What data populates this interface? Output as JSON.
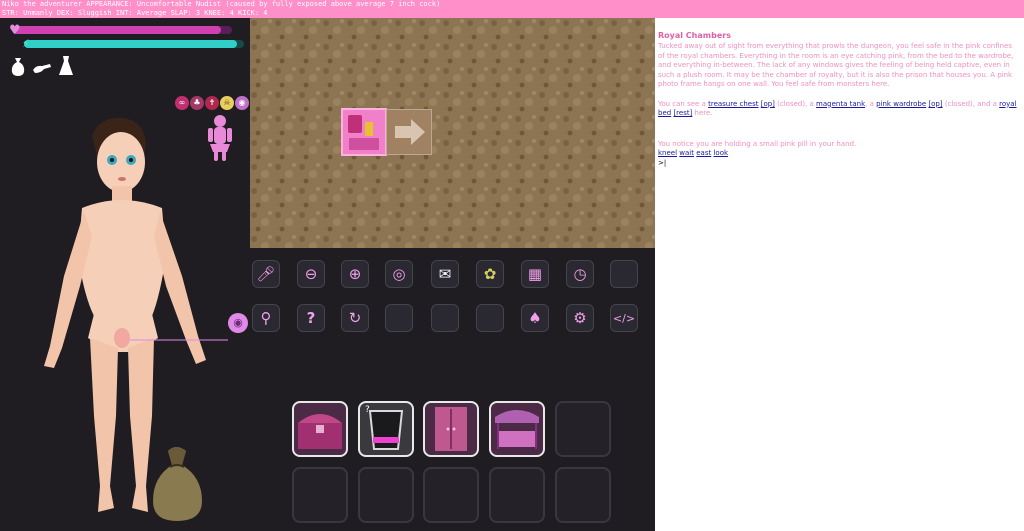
{
  "status": {
    "line1": "Niko the adventurer APPEARANCE: Uncomfortable Nudist (caused by fully exposed above average 7 inch cock)",
    "line2": "STR: Unmanly   DEX: Sluggish  INT: Average    SLAP: 3 KNEE: 4 KICK: 4"
  },
  "bars": {
    "health": 0.95,
    "energy": 0.97
  },
  "colors": {
    "topbar": "#ff8fc8",
    "health": "#d040b0",
    "energy": "#30d0c8",
    "accent": "#f090c0"
  },
  "icons": {
    "clothing": [
      "sack-icon",
      "glove-icon",
      "dress-icon"
    ],
    "status": [
      "infinity-icon",
      "tiered-cake-icon",
      "cross-icon",
      "skull-icon",
      "eye-icon"
    ]
  },
  "toolbar": {
    "row1": [
      "microphone-icon",
      "zoom-out-icon",
      "zoom-in-icon",
      "globe-icon",
      "speech-bubble-icon",
      "brain-icon",
      "inventory-icon",
      "timer-icon",
      "empty"
    ],
    "row2": [
      "map-pin-icon",
      "help-icon",
      "undo-icon",
      "empty",
      "empty",
      "empty",
      "pineapple-icon",
      "gear-icon",
      "code-window-icon"
    ]
  },
  "room_items": {
    "slots": [
      "treasure-chest",
      "magenta-tank",
      "pink-wardrobe",
      "royal-bed",
      "empty",
      "empty",
      "empty",
      "empty",
      "empty",
      "empty"
    ],
    "tank_label": "?"
  },
  "story": {
    "title": "Royal Chambers",
    "description": "Tucked away out of sight from everything that prowls the dungeon, you feel safe in the pink confines of the royal chambers. Everything in the room is an eye catching pink, from the bed to the wardrobe, and everything in-between. The lack of any windows gives the feeling of being held captive, even in such a plush room. It may be the chamber of royalty, but it is also the prison that houses you. A pink photo frame hangs on one wall. You feel safe from monsters here.",
    "see_prefix": "You can see a ",
    "chest": "treasure chest",
    "op": "[op]",
    "closed": " (closed), a ",
    "tank": "magenta tank",
    "comma_a": ", a ",
    "wardrobe": "pink wardrobe",
    "op2": "[op]",
    "closed2": " (closed), and a ",
    "bed": "royal bed",
    "rest": "[rest]",
    "here": " here.",
    "pill": "You notice you are holding a small pink pill in your hand.",
    "commands": [
      "kneel",
      "wait",
      "east",
      "look"
    ],
    "prompt": ">"
  }
}
